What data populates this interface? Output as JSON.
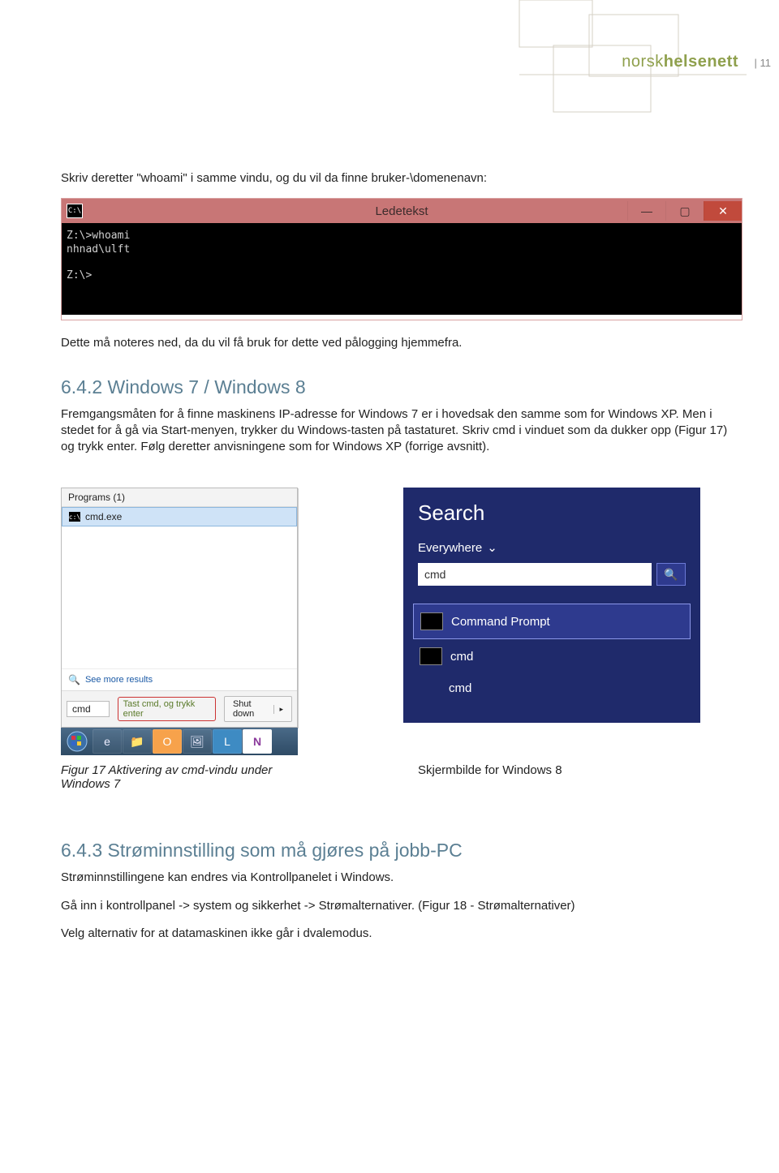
{
  "header": {
    "brand_part1": "norsk",
    "brand_part2": "helsenett",
    "page_number": "| 11"
  },
  "body": {
    "para1": "Skriv deretter \"whoami\" i samme vindu, og du vil da finne bruker-\\domenenavn:",
    "para2": "Dette må noteres ned, da du vil få bruk for dette ved pålogging hjemmefra.",
    "para3": "Fremgangsmåten for å finne maskinens IP-adresse for Windows 7 er i hovedsak den samme som for Windows XP. Men i stedet for å gå via Start-menyen, trykker du Windows-tasten på tastaturet. Skriv cmd i vinduet som da dukker opp (Figur 17) og trykk enter. Følg deretter anvisningene som for Windows XP (forrige avsnitt).",
    "para4": "Strøminnstillingene kan endres via Kontrollpanelet i Windows.",
    "para5": "Gå inn i kontrollpanel -> system og sikkerhet -> Strømalternativer. (Figur 18 - Strømalternativer)",
    "para6": "Velg alternativ for at datamaskinen ikke går i dvalemodus."
  },
  "headings": {
    "h642": "6.4.2  Windows 7 / Windows 8",
    "h643": "6.4.3  Strøminnstilling som må gjøres på jobb-PC"
  },
  "cmd_window": {
    "title": "Ledetekst",
    "icon_label": "C:\\",
    "content": "Z:\\>whoami\nnhnad\\ulft\n\nZ:\\>"
  },
  "win7": {
    "programs_header": "Programs (1)",
    "item_label": "cmd.exe",
    "see_more": "See more results",
    "search_value": "cmd",
    "callout": "Tast cmd, og trykk enter",
    "shutdown": "Shut down"
  },
  "win8": {
    "title": "Search",
    "scope": "Everywhere",
    "input_value": "cmd",
    "result1": "Command Prompt",
    "result2": "cmd",
    "result3": "cmd"
  },
  "captions": {
    "fig17": "Figur 17 Aktivering av cmd-vindu under Windows 7",
    "win8": "Skjermbilde for Windows 8"
  }
}
